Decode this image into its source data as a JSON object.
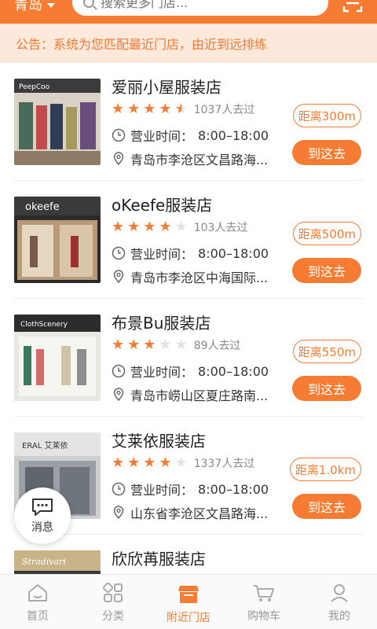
{
  "header": {
    "city": "青岛",
    "search_placeholder": "搜索更多门店..."
  },
  "notice": "公告：系统为您匹配最近门店，由近到远排练",
  "stores": [
    {
      "name": "爱丽小屋服装店",
      "rating": 4.5,
      "visits": "1037人去过",
      "hours_label": "营业时间：",
      "hours": "8:00–18:00",
      "address": "青岛市李沧区文昌路海...",
      "distance": "距离300m",
      "go_label": "到这去"
    },
    {
      "name": "oKeefe服装店",
      "rating": 4,
      "visits": "103人去过",
      "hours_label": "营业时间：",
      "hours": "8:00–18:00",
      "address": "青岛市李沧区中海国际...",
      "distance": "距离500m",
      "go_label": "到这去"
    },
    {
      "name": "布景Bu服装店",
      "rating": 3,
      "visits": "89人去过",
      "hours_label": "营业时间：",
      "hours": "8:00–18:00",
      "address": "青岛市崂山区夏庄路南...",
      "distance": "距离550m",
      "go_label": "到这去"
    },
    {
      "name": "艾莱依服装店",
      "rating": 4,
      "visits": "1337人去过",
      "hours_label": "营业时间：",
      "hours": "8:00–18:00",
      "address": "山东省李沧区文昌路海...",
      "distance": "距离1.0km",
      "go_label": "到这去"
    },
    {
      "name": "欣欣苒服装店"
    }
  ],
  "thumb_signs": [
    "PeepCoo",
    "okeefe",
    "ClothScenery",
    "ERAL 艾莱依",
    "Stradivari"
  ],
  "message_fab": "消息",
  "tabs": [
    {
      "label": "首页",
      "icon": "home-icon"
    },
    {
      "label": "分类",
      "icon": "category-icon"
    },
    {
      "label": "附近门店",
      "icon": "store-icon"
    },
    {
      "label": "购物车",
      "icon": "cart-icon"
    },
    {
      "label": "我的",
      "icon": "profile-icon"
    }
  ],
  "active_tab": 2,
  "colors": {
    "accent": "#f57c32",
    "notice_bg": "#fde9dc"
  }
}
